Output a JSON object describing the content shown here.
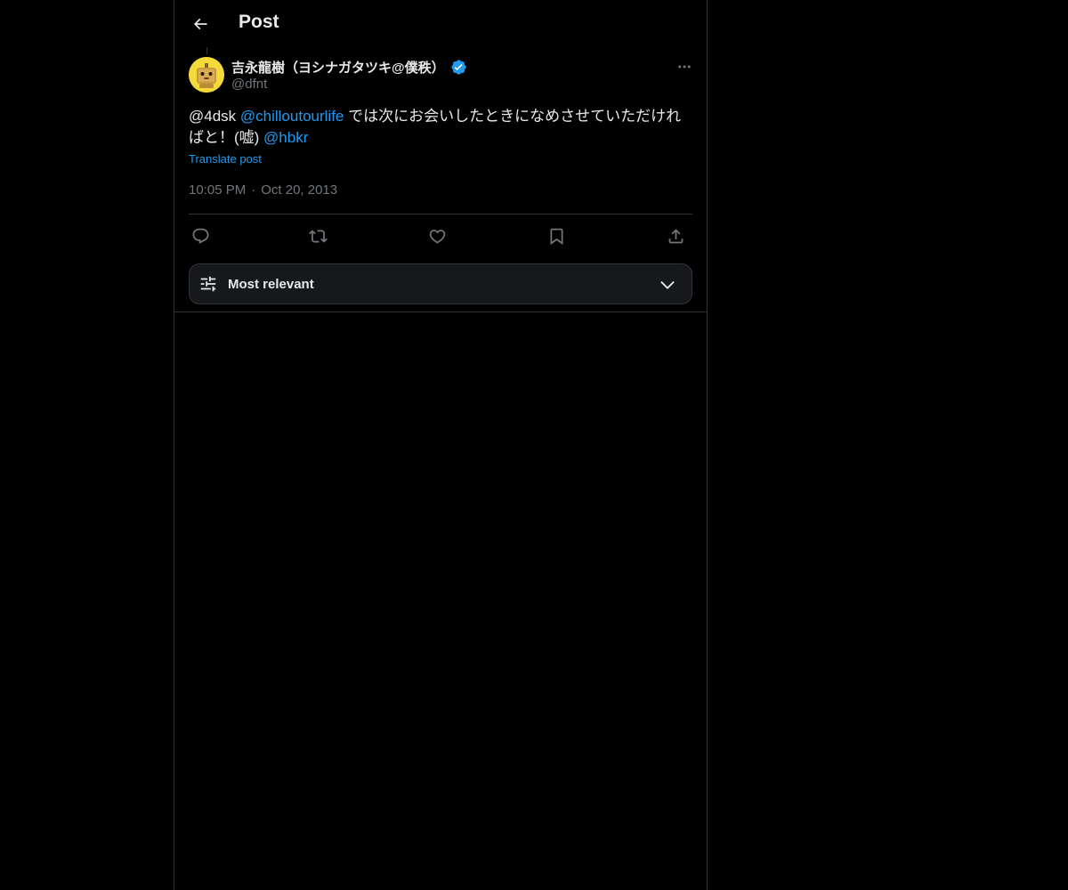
{
  "header": {
    "title": "Post"
  },
  "post": {
    "author": {
      "display_name": "吉永龍樹（ヨシナガタツキ@僕秩）",
      "handle": "@dfnt",
      "verified": true
    },
    "text": {
      "lead": "@4dsk ",
      "mention_1": "@chilloutourlife",
      "middle": " では次にお会いしたときになめさせていただければと！(嘘) ",
      "mention_2": "@hbkr"
    },
    "translate_label": "Translate post",
    "time": "10:05 PM",
    "separator": "·",
    "date": "Oct 20, 2013"
  },
  "actions": {
    "reply": "reply-icon",
    "repost": "repost-icon",
    "like": "heart-icon",
    "bookmark": "bookmark-icon",
    "share": "share-icon"
  },
  "sort": {
    "label": "Most relevant"
  },
  "colors": {
    "background": "#000000",
    "text": "#e7e9ea",
    "muted": "#71767b",
    "accent": "#1d9bf0",
    "border": "#2f3336"
  }
}
